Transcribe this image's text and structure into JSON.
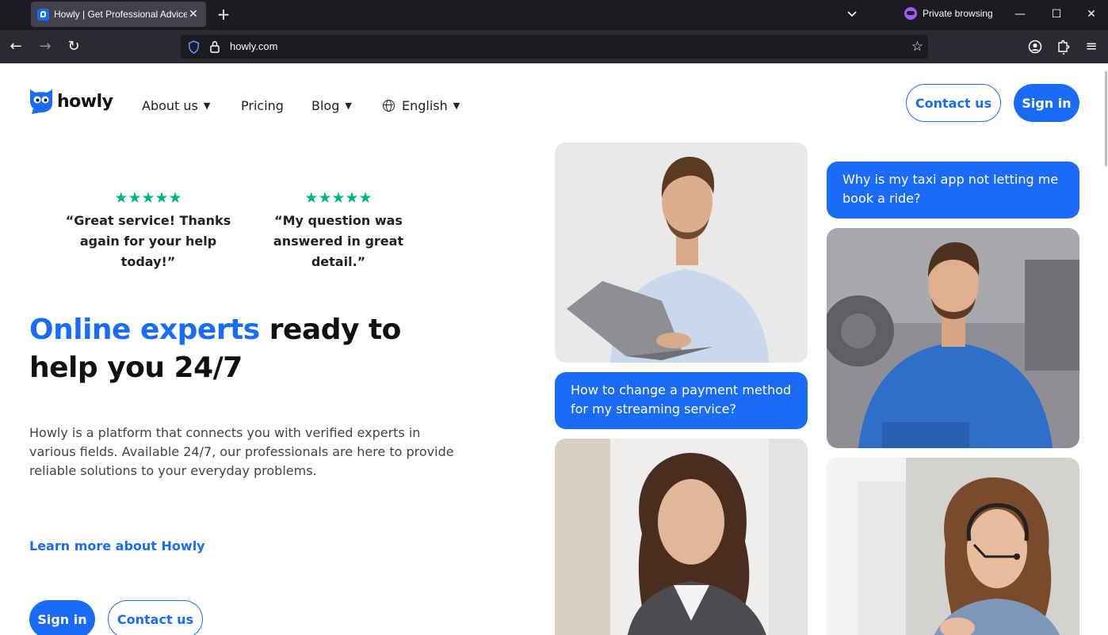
{
  "browser": {
    "tab_title": "Howly | Get Professional Advice",
    "tab_close": "✕",
    "new_tab": "+",
    "private_label": "Private browsing",
    "minimize": "—",
    "maximize": "☐",
    "close": "✕",
    "url": "howly.com",
    "back": "←",
    "forward": "→",
    "reload": "↻",
    "bookmark": "☆",
    "menu": "≡"
  },
  "site": {
    "logo_text": "howly",
    "nav": {
      "about": "About us",
      "pricing": "Pricing",
      "blog": "Blog",
      "language": "English"
    },
    "header_buttons": {
      "contact": "Contact us",
      "signin": "Sign in"
    },
    "reviews": [
      {
        "stars": "★★★★★",
        "text": "“Great service! Thanks again for your help today!”"
      },
      {
        "stars": "★★★★★",
        "text": "“My question was answered in great detail.”"
      }
    ],
    "headline": {
      "accent": "Online experts",
      "rest": " ready to help you 24/7"
    },
    "description": "Howly is a platform that connects you with verified experts in various fields. Available 24/7, our professionals are here to provide reliable solutions to your everyday problems.",
    "learn_more": "Learn more about Howly",
    "cta": {
      "signin": "Sign in",
      "contact": "Contact us"
    },
    "bubbles": [
      "Why is my taxi app not letting me book a ride?",
      "How to change a payment method for my streaming service?"
    ],
    "icons": [
      "howly-logo-icon",
      "chevron-down-icon",
      "globe-icon",
      "star-icon"
    ],
    "colors": {
      "brand_blue": "#1a6cf7",
      "trustpilot_green": "#00b67a",
      "heading": "#111111"
    }
  }
}
